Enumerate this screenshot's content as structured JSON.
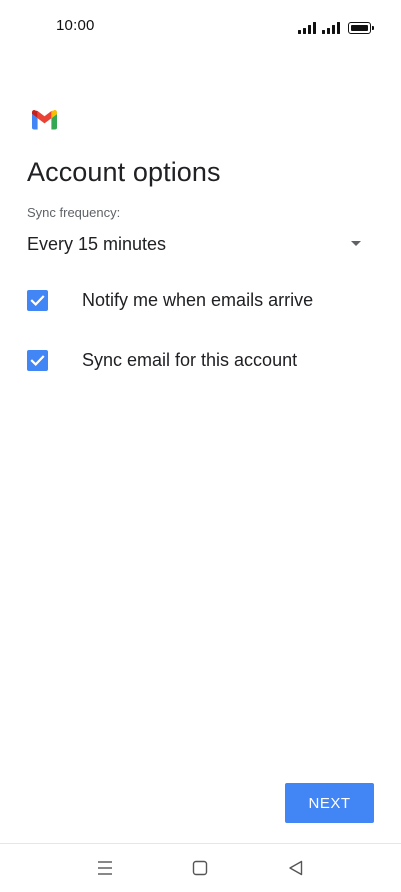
{
  "status_bar": {
    "time": "10:00",
    "icons": [
      "signal-icon",
      "signal-icon",
      "battery-icon"
    ]
  },
  "app": {
    "logo_icon": "gmail-logo-icon",
    "colors": {
      "blue": "#4285F4",
      "red": "#EA4335",
      "yellow": "#FBBC04",
      "green": "#34A853",
      "dark_red": "#C5221F"
    }
  },
  "page": {
    "title": "Account options"
  },
  "sync": {
    "label": "Sync frequency:",
    "selected": "Every 15 minutes",
    "icon": "dropdown-arrow-icon"
  },
  "options": {
    "notify": {
      "label": "Notify me when emails arrive",
      "checked": true
    },
    "sync_email": {
      "label": "Sync email for this account",
      "checked": true
    }
  },
  "actions": {
    "next_label": "NEXT",
    "accent": "#4285F4"
  },
  "nav_bar": {
    "icons": [
      "menu-icon",
      "home-icon",
      "back-icon"
    ]
  }
}
